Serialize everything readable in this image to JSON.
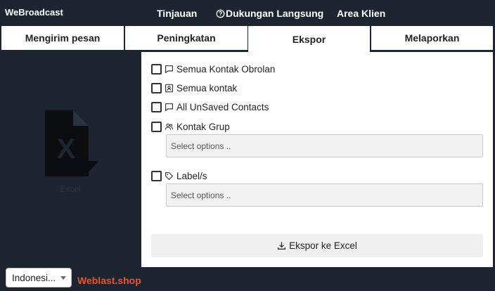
{
  "header": {
    "brand": "WeBroadcast",
    "nav": [
      {
        "label": "Tinjauan",
        "icon": ""
      },
      {
        "label": "Dukungan Langsung",
        "icon": "question-circle-icon"
      },
      {
        "label": "Area Klien",
        "icon": ""
      }
    ]
  },
  "tabs": [
    {
      "label": "Mengirim pesan",
      "active": false
    },
    {
      "label": "Peningkatan",
      "active": false
    },
    {
      "label": "Ekspor",
      "active": true
    },
    {
      "label": "Melaporkan",
      "active": false
    }
  ],
  "sidebar": {
    "icon": "excel-export-icon",
    "caption": "Excel"
  },
  "export_panel": {
    "options": [
      {
        "label": "Semua Kontak Obrolan",
        "icon": "chat-bubble-icon",
        "checked": false
      },
      {
        "label": "Semua kontak",
        "icon": "contact-card-icon",
        "checked": false
      },
      {
        "label": "All UnSaved Contacts",
        "icon": "chat-bubble-icon",
        "checked": false
      },
      {
        "label": "Kontak Grup",
        "icon": "people-icon",
        "checked": false
      },
      {
        "label": "Label/s",
        "icon": "tag-icon",
        "checked": false
      }
    ],
    "group_select_placeholder": "Select options ..",
    "label_select_placeholder": "Select options ..",
    "export_button": "Ekspor ke Excel"
  },
  "footer": {
    "language": "Indonesi...",
    "site": "Weblast.shop"
  },
  "colors": {
    "background": "#1d2530",
    "accent": "#f0502a"
  }
}
